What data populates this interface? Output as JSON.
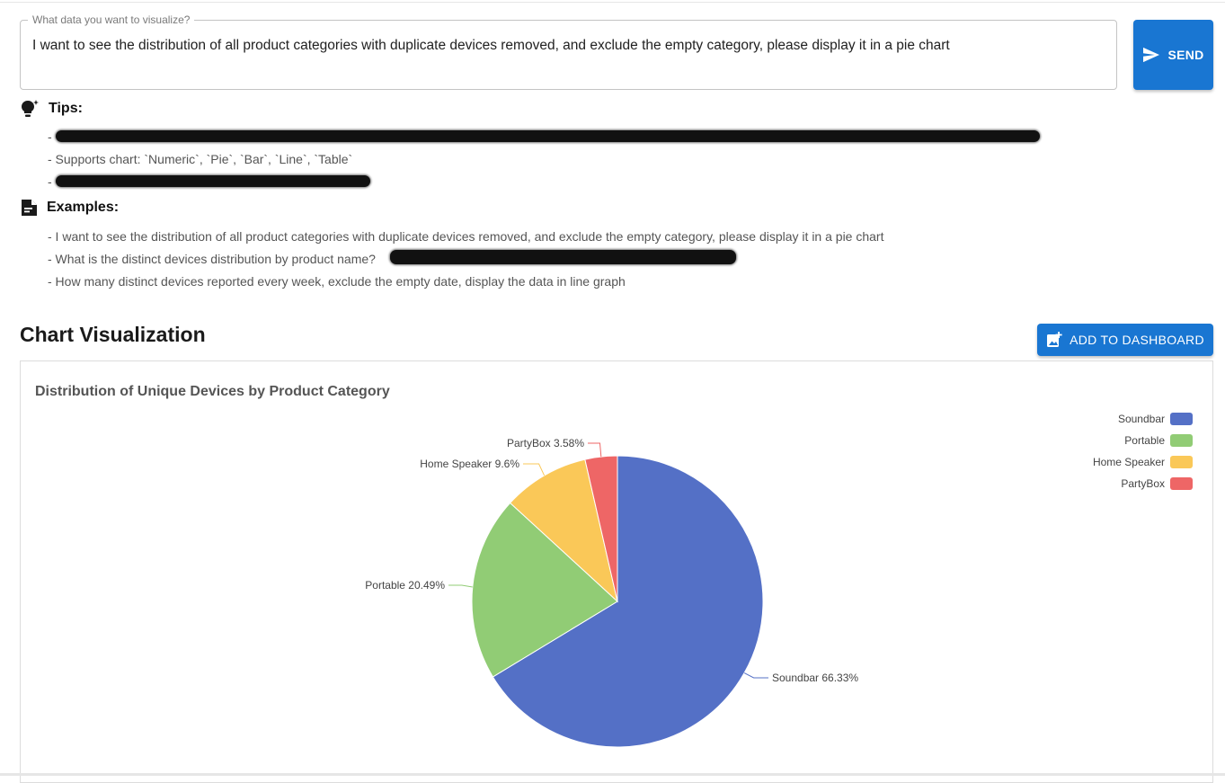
{
  "query": {
    "legend": "What data you want to visualize?",
    "value": "I want to see the distribution of all product categories with duplicate devices removed, and exclude the empty category, please display it in a pie chart",
    "send_label": "SEND"
  },
  "tips": {
    "heading": "Tips:",
    "lines": [
      "-",
      "- Supports chart: `Numeric`, `Pie`, `Bar`, `Line`, `Table`",
      "-"
    ]
  },
  "examples": {
    "heading": "Examples:",
    "lines": [
      "- I want to see the distribution of all product categories with duplicate devices removed, and exclude the empty category, please display it in a pie chart",
      "- What is the distinct devices distribution by product name?",
      "- How many distinct devices reported every week, exclude the empty date, display the data in line graph"
    ]
  },
  "chart_section": {
    "title": "Chart Visualization",
    "add_label": "ADD TO DASHBOARD"
  },
  "colors": {
    "primary": "#1976d2",
    "soundbar": "#5470c6",
    "portable": "#91cc75",
    "home_speaker": "#fac858",
    "partybox": "#ee6666"
  },
  "chart_data": {
    "type": "pie",
    "title": "Distribution of Unique Devices by Product Category",
    "legend_position": "top-right",
    "slices": [
      {
        "name": "Soundbar",
        "value": 66.33,
        "label": "Soundbar 66.33%",
        "color": "#5470c6"
      },
      {
        "name": "Portable",
        "value": 20.49,
        "label": "Portable 20.49%",
        "color": "#91cc75"
      },
      {
        "name": "Home Speaker",
        "value": 9.6,
        "label": "Home Speaker 9.6%",
        "color": "#fac858"
      },
      {
        "name": "PartyBox",
        "value": 3.58,
        "label": "PartyBox 3.58%",
        "color": "#ee6666"
      }
    ]
  }
}
